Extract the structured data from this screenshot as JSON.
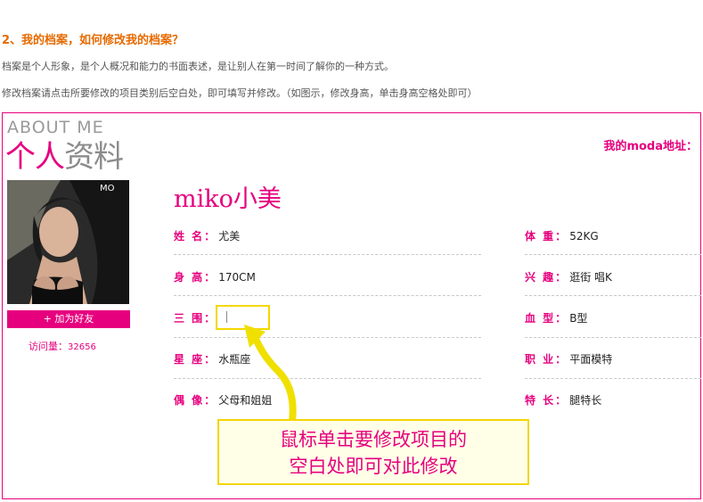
{
  "faq": {
    "title": "2、我的档案，如何修改我的档案？",
    "line1": "档案是个人形象，是个人概况和能力的书面表述，是让别人在第一时间了解你的一种方式。",
    "line2": "修改档案请点击所要修改的项目类别后空白处，即可填写并修改。（如图示，修改身高，单击身高空格处即可）"
  },
  "profile": {
    "about_en": "ABOUT ME",
    "about_cn_pink": "个人",
    "about_cn_gray": "资料",
    "moda_link": "我的moda地址：",
    "user_name": "miko小美",
    "add_friend": "+ 加为好友",
    "visits_label": "访问量：",
    "visits_count": "32656",
    "left_fields": [
      {
        "label": "姓 名：",
        "value": "尤美"
      },
      {
        "label": "身 高：",
        "value": "170CM"
      },
      {
        "label": "三 围：",
        "value": ""
      },
      {
        "label": "星 座：",
        "value": "水瓶座"
      },
      {
        "label": "偶 像：",
        "value": "父母和姐姐"
      }
    ],
    "right_fields": [
      {
        "label": "体 重：",
        "value": "52KG"
      },
      {
        "label": "兴 趣：",
        "value": "逛街 唱K"
      },
      {
        "label": "血 型：",
        "value": "B型"
      },
      {
        "label": "职 业：",
        "value": "平面模特"
      },
      {
        "label": "特 长：",
        "value": "腿特长"
      }
    ]
  },
  "tooltip": {
    "line1": "鼠标单击要修改项目的",
    "line2": "空白处即可对此修改"
  },
  "colors": {
    "accent": "#e6007e",
    "title_orange": "#e66a00",
    "highlight_yellow": "#f5d800"
  }
}
